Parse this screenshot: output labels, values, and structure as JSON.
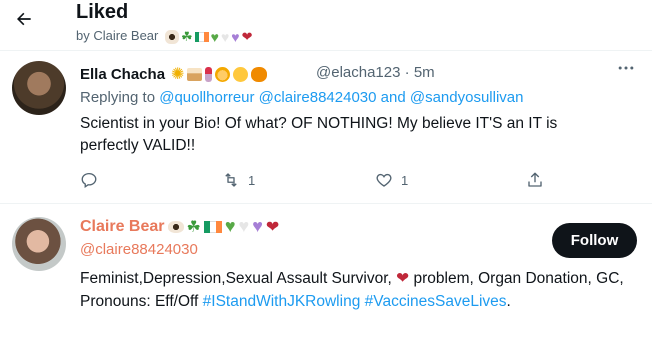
{
  "header": {
    "title": "Liked",
    "subtitle": "by Claire Bear"
  },
  "tweet": {
    "author_name": "Ella Chacha",
    "handle": "@elacha123",
    "separator": "·",
    "time": "5m",
    "replying_prefix": "Replying to",
    "mention_1": "@quollhorreur",
    "mention_2": "@claire88424030",
    "and_word": "and",
    "mention_3": "@sandyosullivan",
    "text": "Scientist in your Bio! Of what? OF NOTHING!  My believe IT'S an IT is perfectly VALID!!",
    "retweet_count": "1",
    "like_count": "1"
  },
  "profile": {
    "name": "Claire Bear",
    "handle": "@claire88424030",
    "follow_label": "Follow",
    "bio_text": "Feminist,Depression,Sexual Assault Survivor,",
    "bio_text_2": "problem, Organ Donation, GC, Pronouns: Eff/Off",
    "hashtag_1": "#IStandWithJKRowling",
    "hashtag_2": "#VaccinesSaveLives",
    "bio_end": "."
  },
  "icons": {
    "back": "back-arrow-icon",
    "more": "more-dots-icon",
    "reply": "reply-icon",
    "retweet": "retweet-icon",
    "like": "heart-icon",
    "share": "share-icon"
  },
  "colors": {
    "accent": "#1d9bf0",
    "profile_name": "#e8795b",
    "follow_button": "#0f1419"
  }
}
